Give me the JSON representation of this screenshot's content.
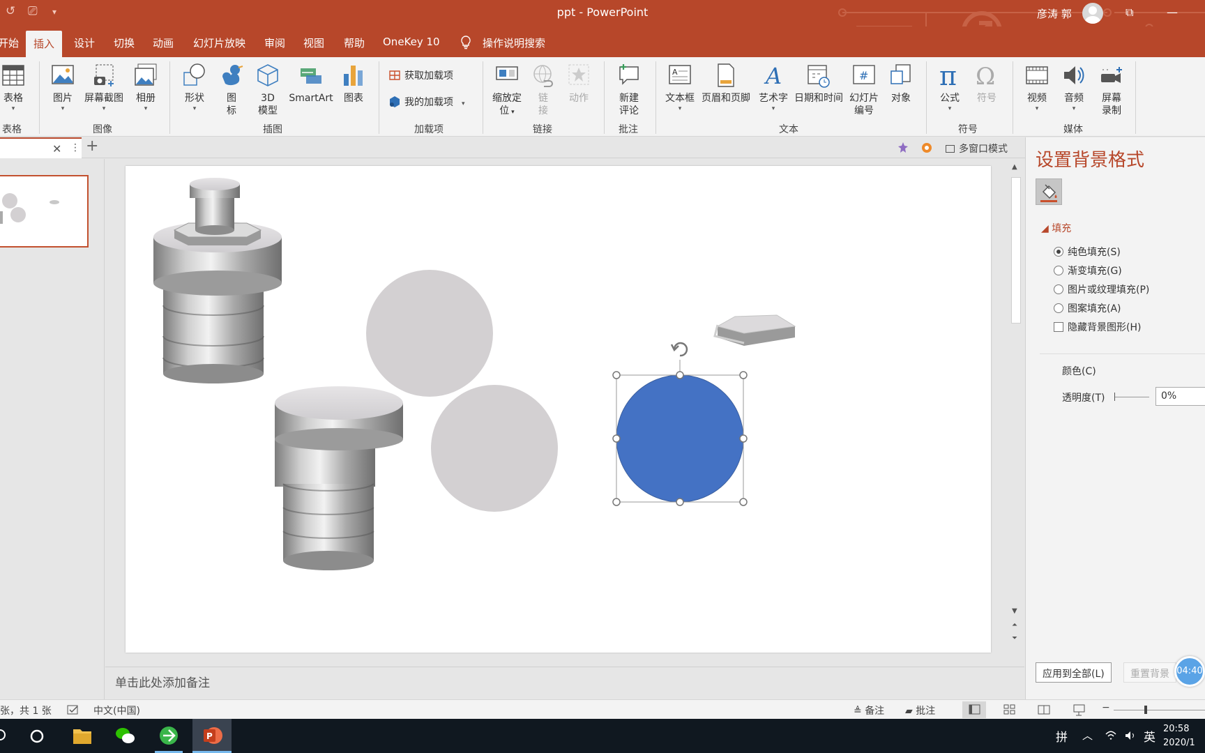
{
  "titlebar": {
    "doc_title": "ppt  -  PowerPoint",
    "user_name": "彦涛 郭",
    "restore_glyph": "⧉",
    "minimize_glyph": "—"
  },
  "tabs": [
    {
      "label": "开始",
      "active": false
    },
    {
      "label": "插入",
      "active": true
    },
    {
      "label": "设计",
      "active": false
    },
    {
      "label": "切换",
      "active": false
    },
    {
      "label": "动画",
      "active": false
    },
    {
      "label": "幻灯片放映",
      "active": false
    },
    {
      "label": "审阅",
      "active": false
    },
    {
      "label": "视图",
      "active": false
    },
    {
      "label": "帮助",
      "active": false
    },
    {
      "label": "OneKey 10",
      "active": false
    }
  ],
  "tell_me": "操作说明搜索",
  "ribbon": {
    "table": "表格",
    "picture": "图片",
    "screenshot": "屏幕截图",
    "album": "相册",
    "shapes": "形状",
    "icons_1": "图",
    "icons_2": "标",
    "model_1": "3D",
    "model_2": "模型",
    "smartart": "SmartArt",
    "chart": "图表",
    "get_addins": "获取加载项",
    "my_addins": "我的加载项",
    "zoom_1": "缩放定",
    "zoom_2": "位",
    "link_1": "链",
    "link_2": "接",
    "action": "动作",
    "comment_1": "新建",
    "comment_2": "评论",
    "textbox": "文本框",
    "header_footer": "页眉和页脚",
    "wordart": "艺术字",
    "datetime": "日期和时间",
    "slidenum_1": "幻灯片",
    "slidenum_2": "编号",
    "object": "对象",
    "equation": "公式",
    "symbol": "符号",
    "video": "视频",
    "audio": "音频",
    "screenrec_1": "屏幕",
    "screenrec_2": "录制",
    "groups": {
      "tables": "表格",
      "images": "图像",
      "illustrations": "插图",
      "addins": "加载项",
      "links": "链接",
      "comments": "批注",
      "text": "文本",
      "symbols": "符号",
      "media": "媒体"
    }
  },
  "slidetabs": {
    "multi_window": "多窗口模式"
  },
  "notes_placeholder": "单击此处添加备注",
  "format_pane": {
    "title": "设置背景格式",
    "section": "填充",
    "options": [
      {
        "label": "纯色填充(S)",
        "selected": true
      },
      {
        "label": "渐变填充(G)",
        "selected": false
      },
      {
        "label": "图片或纹理填充(P)",
        "selected": false
      },
      {
        "label": "图案填充(A)",
        "selected": false
      }
    ],
    "hide_graphics": "隐藏背景图形(H)",
    "color_label": "颜色(C)",
    "transparency_label": "透明度(T)",
    "transparency_value": "0%",
    "apply_all": "应用到全部(L)",
    "reset": "重置背景",
    "timer": "04:40"
  },
  "statusbar": {
    "slide_info": "张，共 1 张",
    "language": "中文(中国)",
    "notes": "备注",
    "comments": "批注"
  },
  "taskbar": {
    "ime1": "拼",
    "ime2": "英",
    "time": "20:58",
    "date": "2020/1"
  },
  "colors": {
    "accent": "#b7472a",
    "selected_shape": "#4472c4",
    "gray_shape": "#d3d0d2"
  }
}
